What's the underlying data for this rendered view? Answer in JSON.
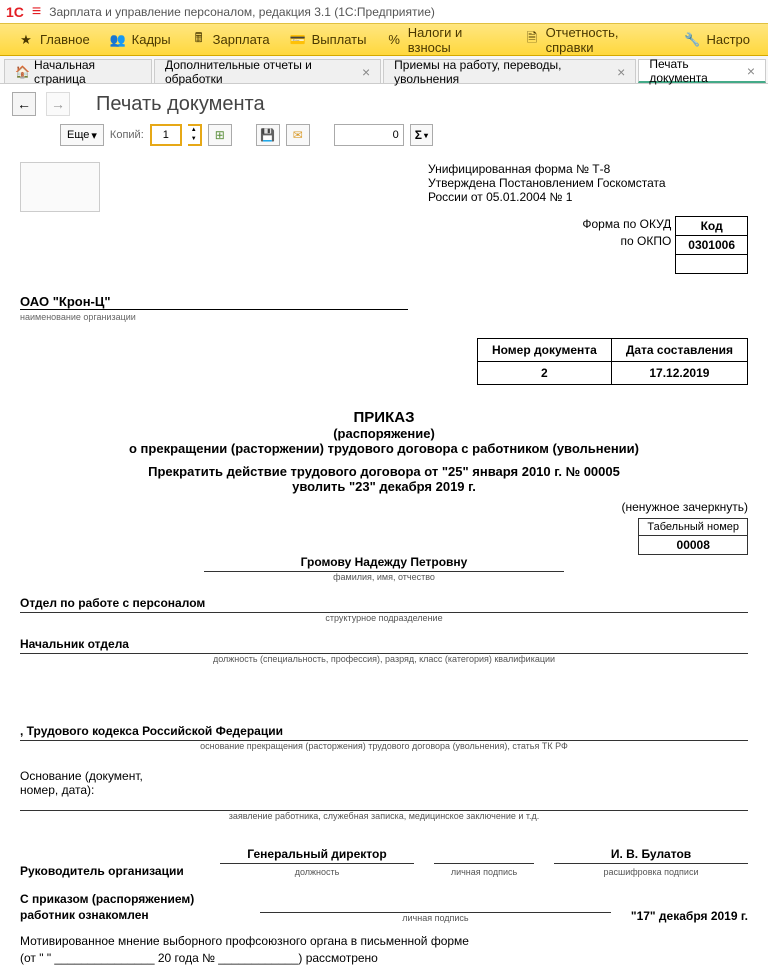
{
  "window": {
    "title": "Зарплата и управление персоналом, редакция 3.1  (1C:Предприятие)"
  },
  "mainmenu": {
    "items": [
      {
        "label": "Главное"
      },
      {
        "label": "Кадры"
      },
      {
        "label": "Зарплата"
      },
      {
        "label": "Выплаты"
      },
      {
        "label": "Налоги и взносы"
      },
      {
        "label": "Отчетность, справки"
      },
      {
        "label": "Настро"
      }
    ]
  },
  "tabs": {
    "items": [
      {
        "label": "Начальная страница",
        "home": true
      },
      {
        "label": "Дополнительные отчеты и обработки"
      },
      {
        "label": "Приемы на работу, переводы, увольнения"
      },
      {
        "label": "Печать документа",
        "active": true
      }
    ]
  },
  "page": {
    "title": "Печать документа",
    "more_btn": "Еще",
    "copies_label": "Копий:",
    "copies_value": "1",
    "small_input_value": "0",
    "sigma": "Σ"
  },
  "doc": {
    "form_header_l1": "Унифицированная форма № Т-8",
    "form_header_l2": "Утверждена Постановлением Госкомстата",
    "form_header_l3": "России от 05.01.2004 № 1",
    "kod_hdr": "Код",
    "okud_label": "Форма по ОКУД",
    "okud": "0301006",
    "okpo_label": "по ОКПО",
    "org_name": "ОАО \"Крон-Ц\"",
    "org_caption": "наименование организации",
    "docnum_hdr1": "Номер документа",
    "docnum_hdr2": "Дата составления",
    "docnum_val": "2",
    "docdate_val": "17.12.2019",
    "title1": "ПРИКАЗ",
    "title2": "(распоряжение)",
    "title3": "о прекращении (расторжении) трудового договора с работником (увольнении)",
    "stmt1": "Прекратить действие трудового договора от  \"25\" января 2010 г. № 00005",
    "stmt2": "уволить  \"23\" декабря 2019 г.",
    "note": "(ненужное зачеркнуть)",
    "tabno_label": "Табельный номер",
    "tabno": "00008",
    "name": "Громову Надежду Петровну",
    "name_caption": "фамилия, имя, отчество",
    "dept": "Отдел по работе с персоналом",
    "dept_caption": "структурное подразделение",
    "position": "Начальник отдела",
    "position_caption": "должность (специальность, профессия), разряд, класс (категория) квалификации",
    "basis_law": ", Трудового кодекса Российской Федерации",
    "basis_caption": "основание прекращения (расторжения) трудового договора (увольнения), статья ТК РФ",
    "osnovanie_label_l1": "Основание (документ,",
    "osnovanie_label_l2": "номер, дата):",
    "osnovanie_caption": "заявление работника, служебная записка, медицинское заключение и т.д.",
    "mgr_label": "Руководитель организации",
    "mgr_position": "Генеральный директор",
    "mgr_position_caption": "должность",
    "mgr_sign_caption": "личная подпись",
    "mgr_name": "И. В. Булатов",
    "mgr_name_caption": "расшифровка  подписи",
    "ack_l1": "С приказом (распоряжением)",
    "ack_l2": "работник ознакомлен",
    "ack_sign_caption": "личная подпись",
    "ack_date": "\"17\" декабря 2019 г.",
    "union_l1": "Мотивированное мнение выборного профсоюзного органа в письменной форме",
    "union_l2": "(от \"        \" _______________ 20        года № ____________) рассмотрено"
  }
}
